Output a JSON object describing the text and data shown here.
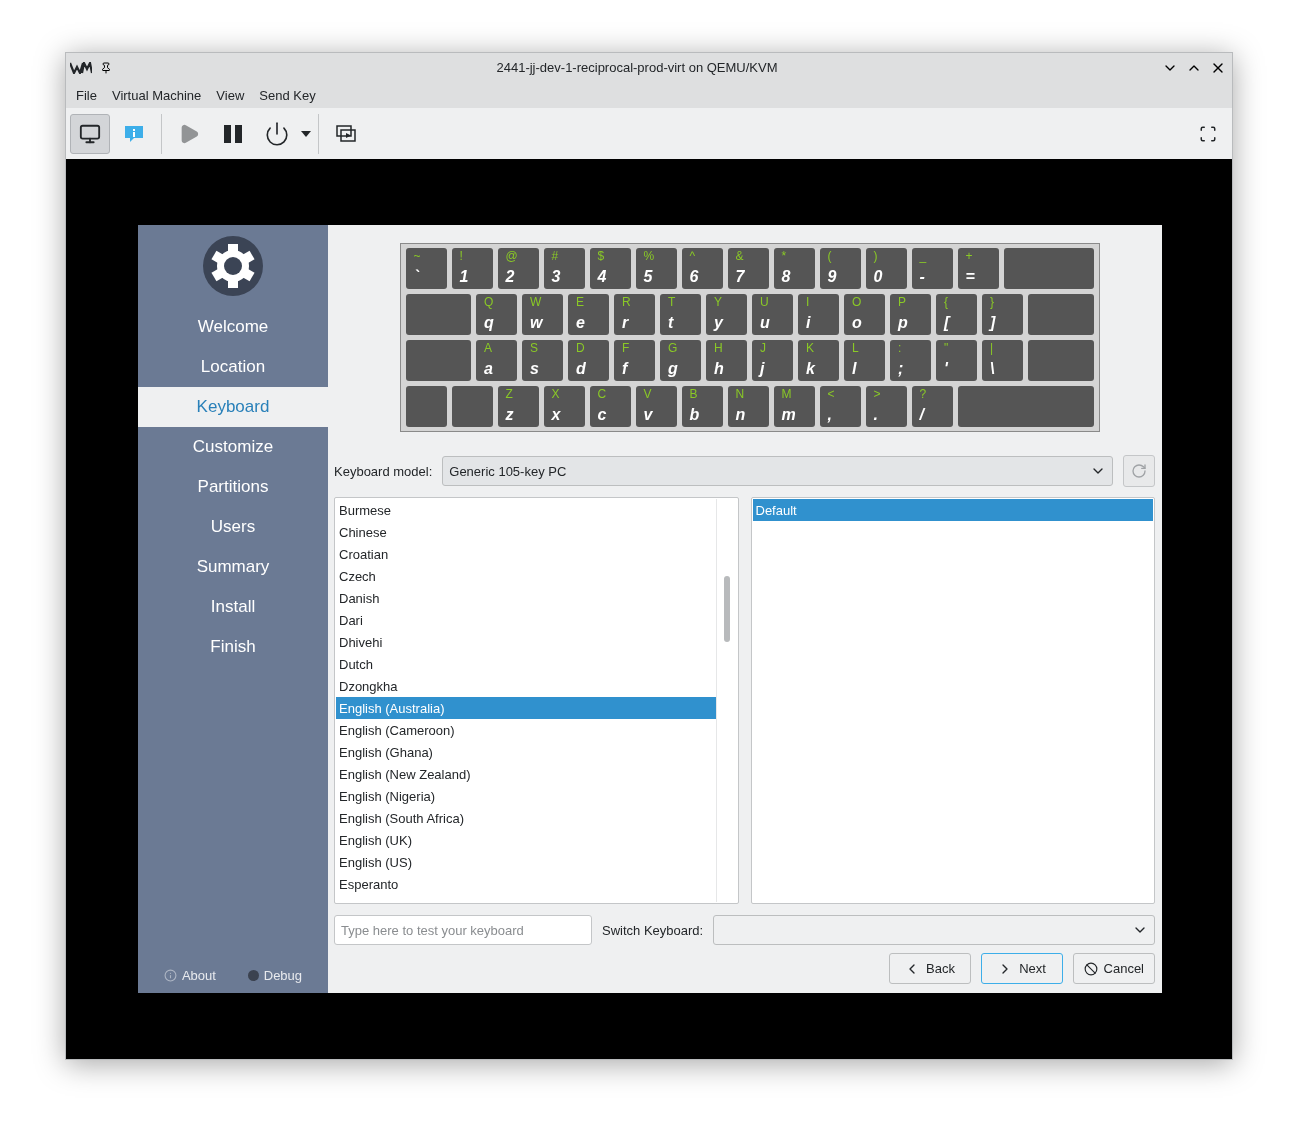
{
  "window": {
    "title": "2441-jj-dev-1-reciprocal-prod-virt on QEMU/KVM"
  },
  "menu": [
    "File",
    "Virtual Machine",
    "View",
    "Send Key"
  ],
  "toolbar": [
    {
      "kind": "console",
      "selected": true,
      "disabled": false
    },
    {
      "kind": "details",
      "selected": false,
      "disabled": false
    },
    {
      "kind": "run",
      "selected": false,
      "disabled": true
    },
    {
      "kind": "pause",
      "selected": false,
      "disabled": false
    },
    {
      "kind": "power",
      "selected": false,
      "disabled": false
    },
    {
      "kind": "snapshots",
      "selected": false,
      "disabled": false
    }
  ],
  "sidebar": {
    "steps": [
      {
        "label": "Welcome",
        "selected": false
      },
      {
        "label": "Location",
        "selected": false
      },
      {
        "label": "Keyboard",
        "selected": true
      },
      {
        "label": "Customize",
        "selected": false
      },
      {
        "label": "Partitions",
        "selected": false
      },
      {
        "label": "Users",
        "selected": false
      },
      {
        "label": "Summary",
        "selected": false
      },
      {
        "label": "Install",
        "selected": false
      },
      {
        "label": "Finish",
        "selected": false
      }
    ],
    "footer": [
      {
        "kind": "about",
        "label": "About"
      },
      {
        "kind": "debug",
        "label": "Debug"
      }
    ]
  },
  "keyboard_preview": {
    "rows": [
      [
        {
          "kind": "key",
          "upper": "~",
          "lower": "`"
        },
        {
          "kind": "key",
          "upper": "!",
          "lower": "1"
        },
        {
          "kind": "key",
          "upper": "@",
          "lower": "2"
        },
        {
          "kind": "key",
          "upper": "#",
          "lower": "3"
        },
        {
          "kind": "key",
          "upper": "$",
          "lower": "4"
        },
        {
          "kind": "key",
          "upper": "%",
          "lower": "5"
        },
        {
          "kind": "key",
          "upper": "^",
          "lower": "6"
        },
        {
          "kind": "key",
          "upper": "&",
          "lower": "7"
        },
        {
          "kind": "key",
          "upper": "*",
          "lower": "8"
        },
        {
          "kind": "key",
          "upper": "(",
          "lower": "9"
        },
        {
          "kind": "key",
          "upper": ")",
          "lower": "0"
        },
        {
          "kind": "key",
          "upper": "_",
          "lower": "-"
        },
        {
          "kind": "key",
          "upper": "+",
          "lower": "="
        },
        {
          "kind": "wide"
        }
      ],
      [
        {
          "kind": "wide"
        },
        {
          "kind": "key",
          "upper": "Q",
          "lower": "q"
        },
        {
          "kind": "key",
          "upper": "W",
          "lower": "w"
        },
        {
          "kind": "key",
          "upper": "E",
          "lower": "e"
        },
        {
          "kind": "key",
          "upper": "R",
          "lower": "r"
        },
        {
          "kind": "key",
          "upper": "T",
          "lower": "t"
        },
        {
          "kind": "key",
          "upper": "Y",
          "lower": "y"
        },
        {
          "kind": "key",
          "upper": "U",
          "lower": "u"
        },
        {
          "kind": "key",
          "upper": "I",
          "lower": "i"
        },
        {
          "kind": "key",
          "upper": "O",
          "lower": "o"
        },
        {
          "kind": "key",
          "upper": "P",
          "lower": "p"
        },
        {
          "kind": "key",
          "upper": "{",
          "lower": "["
        },
        {
          "kind": "key",
          "upper": "}",
          "lower": "]"
        },
        {
          "kind": "wide"
        }
      ],
      [
        {
          "kind": "wide"
        },
        {
          "kind": "key",
          "upper": "A",
          "lower": "a"
        },
        {
          "kind": "key",
          "upper": "S",
          "lower": "s"
        },
        {
          "kind": "key",
          "upper": "D",
          "lower": "d"
        },
        {
          "kind": "key",
          "upper": "F",
          "lower": "f"
        },
        {
          "kind": "key",
          "upper": "G",
          "lower": "g"
        },
        {
          "kind": "key",
          "upper": "H",
          "lower": "h"
        },
        {
          "kind": "key",
          "upper": "J",
          "lower": "j"
        },
        {
          "kind": "key",
          "upper": "K",
          "lower": "k"
        },
        {
          "kind": "key",
          "upper": "L",
          "lower": "l"
        },
        {
          "kind": "key",
          "upper": ":",
          "lower": ";"
        },
        {
          "kind": "key",
          "upper": "\"",
          "lower": "'"
        },
        {
          "kind": "key",
          "upper": "|",
          "lower": "\\"
        },
        {
          "kind": "wide"
        }
      ],
      [
        {
          "kind": "blank"
        },
        {
          "kind": "blank"
        },
        {
          "kind": "key",
          "upper": "Z",
          "lower": "z"
        },
        {
          "kind": "key",
          "upper": "X",
          "lower": "x"
        },
        {
          "kind": "key",
          "upper": "C",
          "lower": "c"
        },
        {
          "kind": "key",
          "upper": "V",
          "lower": "v"
        },
        {
          "kind": "key",
          "upper": "B",
          "lower": "b"
        },
        {
          "kind": "key",
          "upper": "N",
          "lower": "n"
        },
        {
          "kind": "key",
          "upper": "M",
          "lower": "m"
        },
        {
          "kind": "key",
          "upper": "<",
          "lower": ","
        },
        {
          "kind": "key",
          "upper": ">",
          "lower": "."
        },
        {
          "kind": "key",
          "upper": "?",
          "lower": "/"
        },
        {
          "kind": "wide"
        }
      ]
    ]
  },
  "model": {
    "label": "Keyboard model:",
    "value": "Generic 105-key PC"
  },
  "layouts": [
    {
      "label": "Burmese",
      "selected": false
    },
    {
      "label": "Chinese",
      "selected": false
    },
    {
      "label": "Croatian",
      "selected": false
    },
    {
      "label": "Czech",
      "selected": false
    },
    {
      "label": "Danish",
      "selected": false
    },
    {
      "label": "Dari",
      "selected": false
    },
    {
      "label": "Dhivehi",
      "selected": false
    },
    {
      "label": "Dutch",
      "selected": false
    },
    {
      "label": "Dzongkha",
      "selected": false
    },
    {
      "label": "English (Australia)",
      "selected": true
    },
    {
      "label": "English (Cameroon)",
      "selected": false
    },
    {
      "label": "English (Ghana)",
      "selected": false
    },
    {
      "label": "English (New Zealand)",
      "selected": false
    },
    {
      "label": "English (Nigeria)",
      "selected": false
    },
    {
      "label": "English (South Africa)",
      "selected": false
    },
    {
      "label": "English (UK)",
      "selected": false
    },
    {
      "label": "English (US)",
      "selected": false
    },
    {
      "label": "Esperanto",
      "selected": false
    }
  ],
  "variants": [
    {
      "label": "Default",
      "selected": true
    }
  ],
  "test_field": {
    "placeholder": "Type here to test your keyboard"
  },
  "switch_keyboard": {
    "label": "Switch Keyboard:"
  },
  "buttons": [
    {
      "kind": "back",
      "label": "Back"
    },
    {
      "kind": "next",
      "label": "Next"
    },
    {
      "kind": "cancel",
      "label": "Cancel"
    }
  ]
}
